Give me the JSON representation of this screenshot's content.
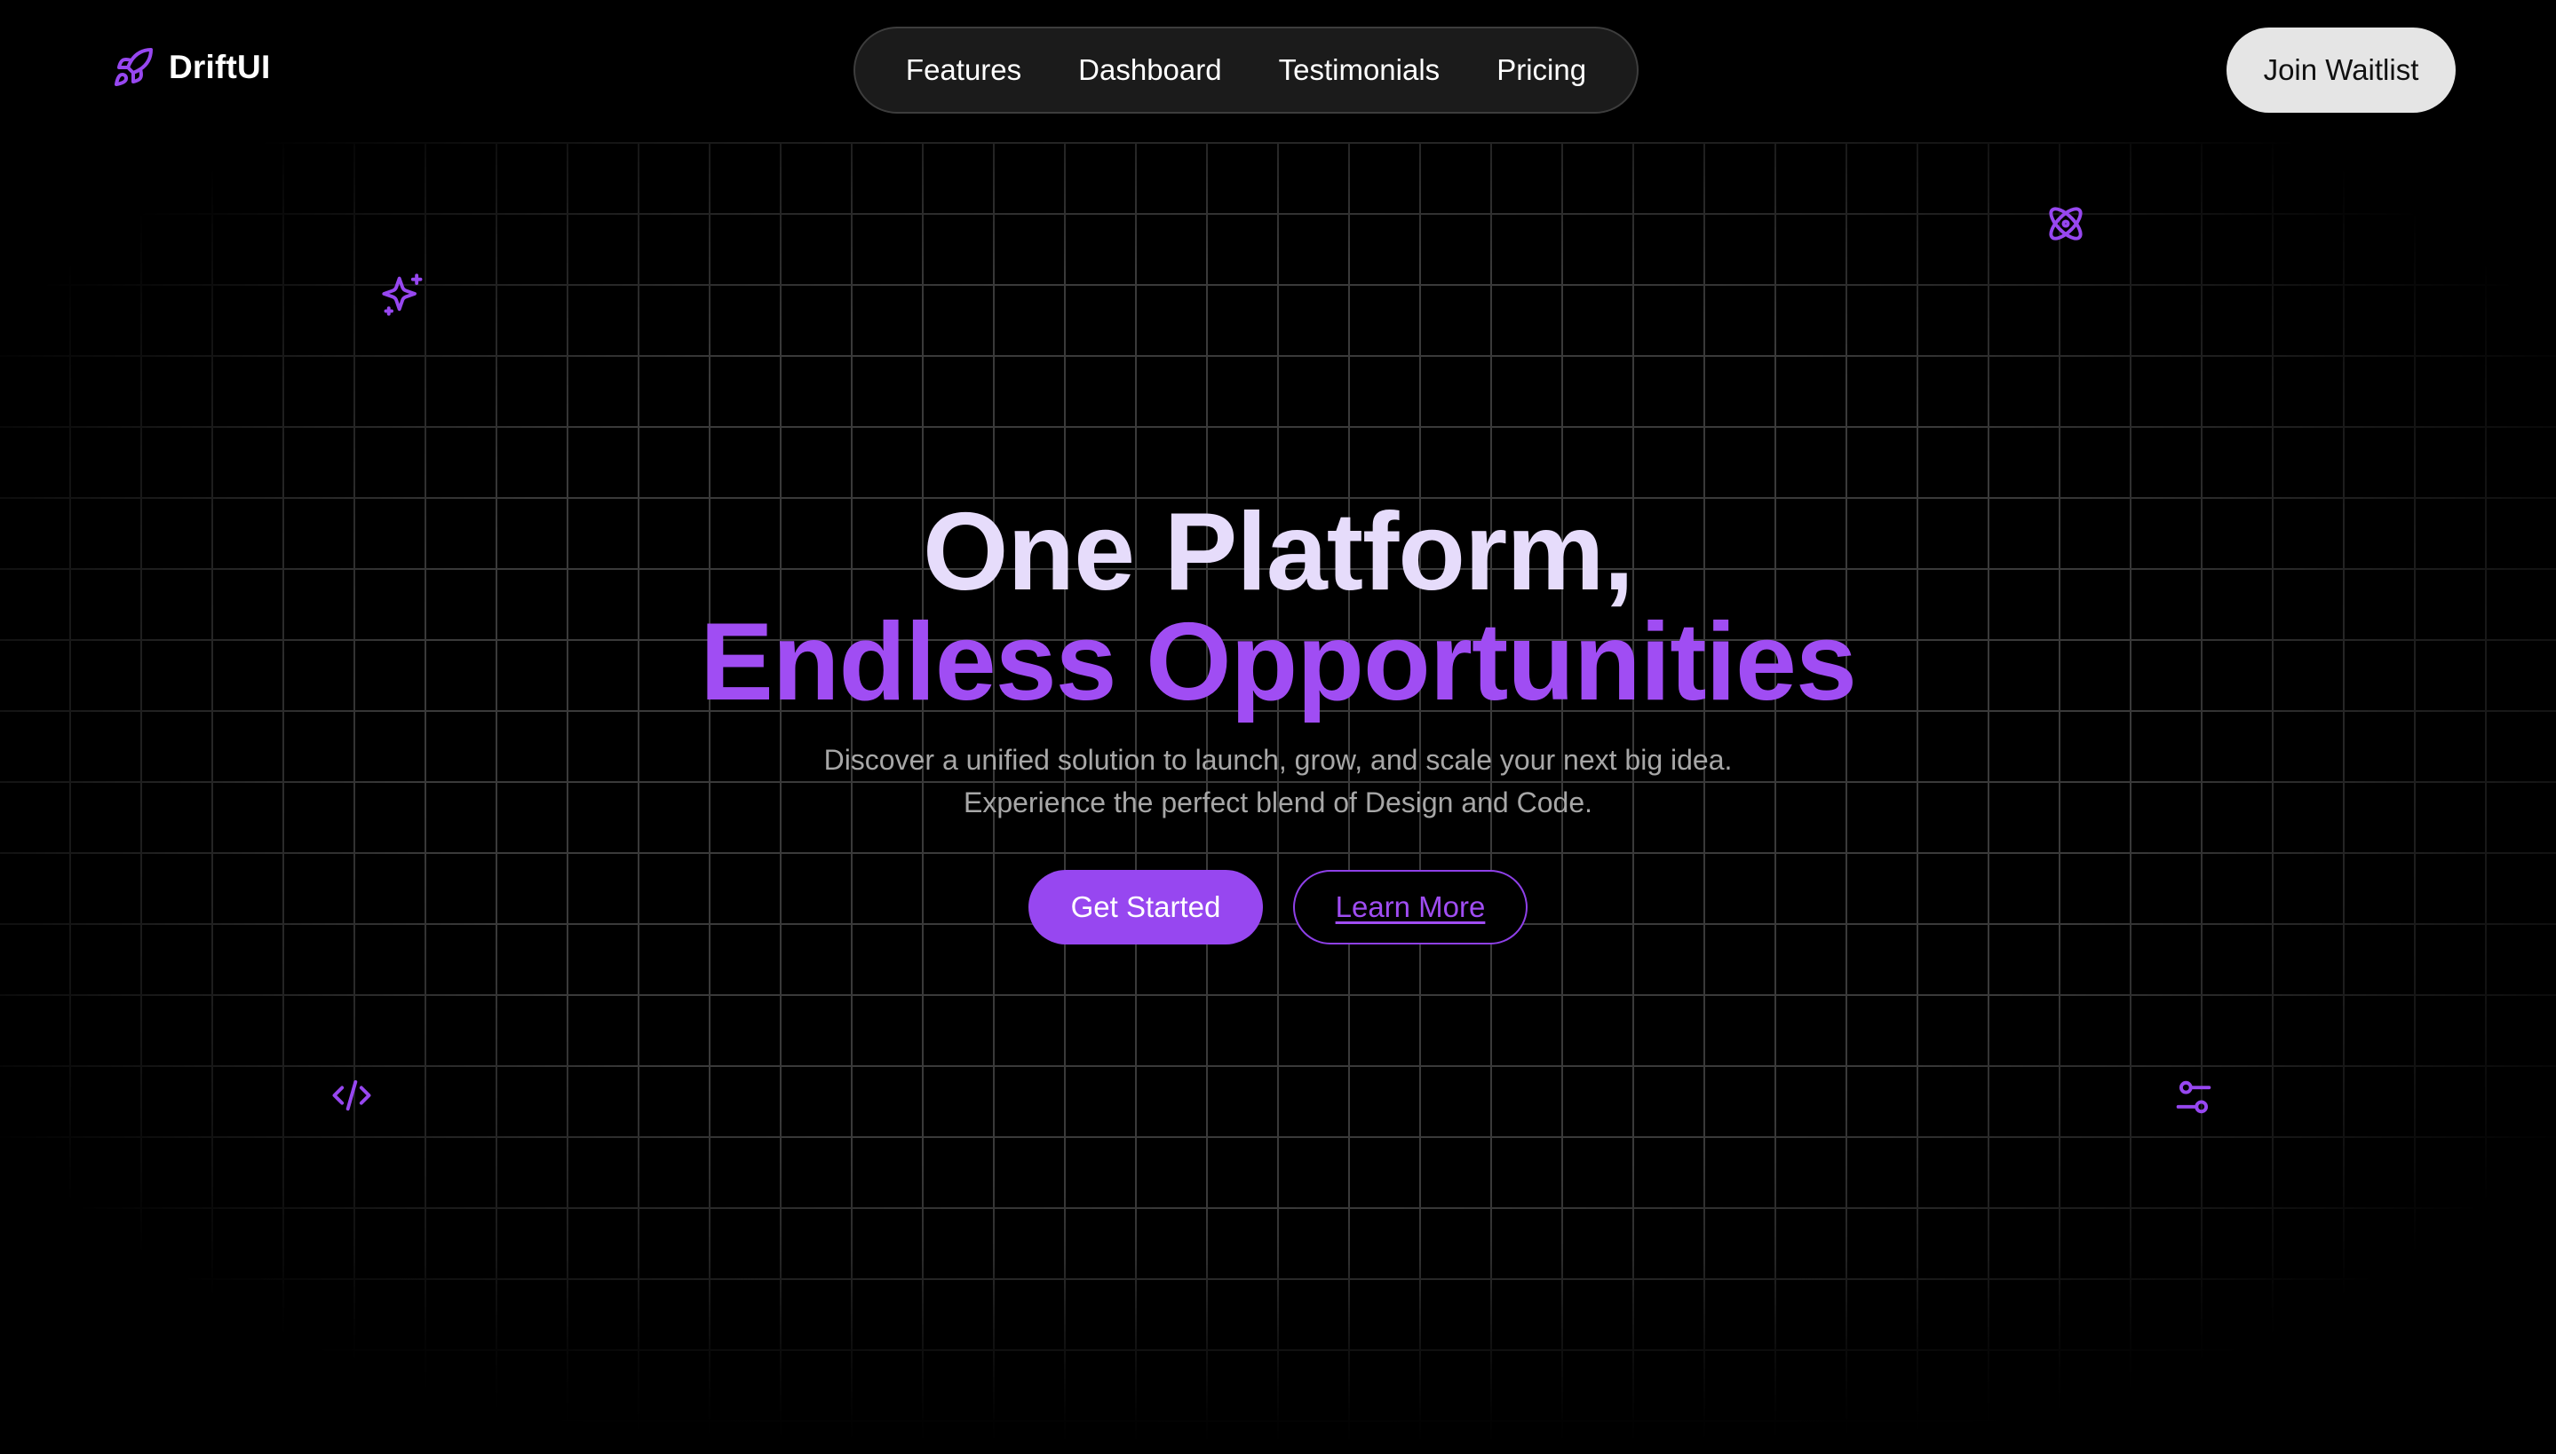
{
  "brand": {
    "name": "DriftUI",
    "icon": "rocket-icon",
    "accent_color": "#9747f0"
  },
  "nav": {
    "items": [
      {
        "label": "Features"
      },
      {
        "label": "Dashboard"
      },
      {
        "label": "Testimonials"
      },
      {
        "label": "Pricing"
      }
    ]
  },
  "header": {
    "cta_label": "Join Waitlist"
  },
  "hero": {
    "title_line1": "One Platform,",
    "title_line2": "Endless Opportunities",
    "subtitle_line1": "Discover a unified solution to launch, grow, and scale your next big idea.",
    "subtitle_line2": "Experience the perfect blend of Design and Code.",
    "primary_cta": "Get Started",
    "secondary_cta": "Learn More"
  },
  "decorative_icons": [
    "sparkles-icon",
    "atom-icon",
    "code-icon",
    "settings-sliders-icon"
  ],
  "colors": {
    "background": "#000000",
    "grid_line": "#3a3a3a",
    "title_light": "#e6dcfb",
    "title_accent": "#a04df3",
    "subtitle": "#a7a7a7"
  }
}
